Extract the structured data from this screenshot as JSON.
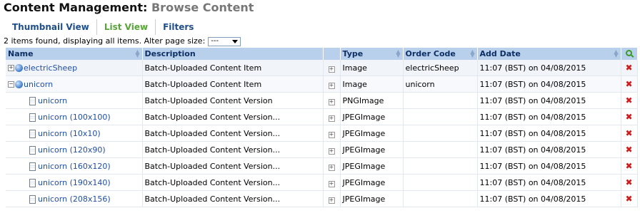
{
  "header": {
    "title_main": "Content Management:",
    "title_sub": "Browse Content"
  },
  "tabs": [
    {
      "label": "Thumbnail View",
      "active": false
    },
    {
      "label": "List View",
      "active": true
    },
    {
      "label": "Filters",
      "active": false
    }
  ],
  "info": {
    "text": "2 items found, displaying all items. Alter page size:",
    "page_size": "---"
  },
  "columns": {
    "name": "Name",
    "description": "Description",
    "type": "Type",
    "order_code": "Order Code",
    "add_date": "Add Date"
  },
  "rows": [
    {
      "expander": "+",
      "icon": "globe-icon",
      "name": "electricSheep",
      "description": "Batch-Uploaded Content Item",
      "type": "Image",
      "order_code": "electricSheep",
      "add_date": "11:07 (BST) on 04/08/2015"
    },
    {
      "expander": "−",
      "icon": "globe-icon",
      "name": "unicorn",
      "description": "Batch-Uploaded Content Item",
      "type": "Image",
      "order_code": "unicorn",
      "add_date": "11:07 (BST) on 04/08/2015"
    },
    {
      "expander": "",
      "icon": "document-icon",
      "name": "unicorn",
      "description": "Batch-Uploaded Content Version",
      "type": "PNGImage",
      "order_code": "",
      "add_date": "11:07 (BST) on 04/08/2015"
    },
    {
      "expander": "",
      "icon": "document-icon",
      "name": "unicorn (100x100)",
      "description": "Batch-Uploaded Content Version...",
      "type": "JPEGImage",
      "order_code": "",
      "add_date": "11:07 (BST) on 04/08/2015"
    },
    {
      "expander": "",
      "icon": "document-icon",
      "name": "unicorn (10x10)",
      "description": "Batch-Uploaded Content Version...",
      "type": "JPEGImage",
      "order_code": "",
      "add_date": "11:07 (BST) on 04/08/2015"
    },
    {
      "expander": "",
      "icon": "document-icon",
      "name": "unicorn (120x90)",
      "description": "Batch-Uploaded Content Version...",
      "type": "JPEGImage",
      "order_code": "",
      "add_date": "11:07 (BST) on 04/08/2015"
    },
    {
      "expander": "",
      "icon": "document-icon",
      "name": "unicorn (160x120)",
      "description": "Batch-Uploaded Content Version...",
      "type": "JPEGImage",
      "order_code": "",
      "add_date": "11:07 (BST) on 04/08/2015"
    },
    {
      "expander": "",
      "icon": "document-icon",
      "name": "unicorn (190x140)",
      "description": "Batch-Uploaded Content Version...",
      "type": "JPEGImage",
      "order_code": "",
      "add_date": "11:07 (BST) on 04/08/2015"
    },
    {
      "expander": "",
      "icon": "document-icon",
      "name": "unicorn (208x156)",
      "description": "Batch-Uploaded Content Version...",
      "type": "JPEGImage",
      "order_code": "",
      "add_date": "11:07 (BST) on 04/08/2015"
    }
  ],
  "row_action_icon": "delete-icon",
  "header_action_icon": "search-icon",
  "colors": {
    "header_bg": "#b9d0ec",
    "link": "#1f4ea8",
    "active_tab": "#59a43a",
    "delete": "#d11a1a"
  }
}
